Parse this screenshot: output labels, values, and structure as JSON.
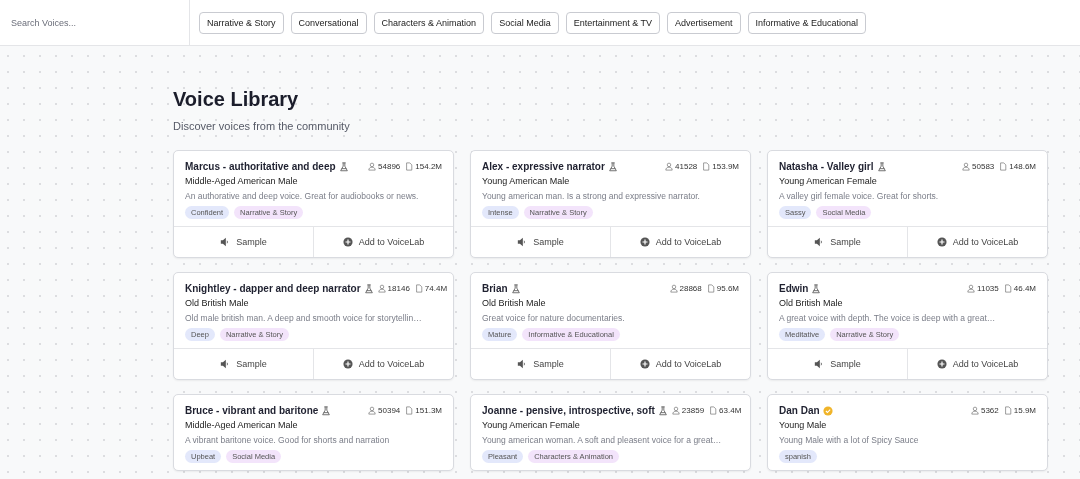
{
  "search": {
    "placeholder": "Search Voices..."
  },
  "filters": [
    {
      "label": "Narrative & Story"
    },
    {
      "label": "Conversational"
    },
    {
      "label": "Characters & Animation"
    },
    {
      "label": "Social Media"
    },
    {
      "label": "Entertainment & TV"
    },
    {
      "label": "Advertisement"
    },
    {
      "label": "Informative & Educational"
    }
  ],
  "heading": {
    "title": "Voice Library",
    "subtitle": "Discover voices from the community"
  },
  "voices": [
    {
      "name": "Marcus - authoritative and deep",
      "lab": true,
      "verified": false,
      "users": "54896",
      "size": "154.2M",
      "type": "Middle-Aged American Male",
      "description": "An authorative and deep voice. Great for audiobooks or news.",
      "tags": [
        {
          "label": "Confident",
          "kind": "mood"
        },
        {
          "label": "Narrative & Story",
          "kind": "category"
        }
      ],
      "actions": [
        {
          "label": "Sample",
          "kind": "sample"
        },
        {
          "label": "Add to VoiceLab",
          "kind": "add"
        }
      ]
    },
    {
      "name": "Alex - expressive narrator",
      "lab": true,
      "verified": false,
      "users": "41528",
      "size": "153.9M",
      "type": "Young American Male",
      "description": "Young american man. Is a strong and expressive narrator.",
      "tags": [
        {
          "label": "Intense",
          "kind": "mood"
        },
        {
          "label": "Narrative & Story",
          "kind": "category"
        }
      ],
      "actions": [
        {
          "label": "Sample",
          "kind": "sample"
        },
        {
          "label": "Add to VoiceLab",
          "kind": "add"
        }
      ]
    },
    {
      "name": "Natasha - Valley girl",
      "lab": true,
      "verified": false,
      "users": "50583",
      "size": "148.6M",
      "type": "Young American Female",
      "description": "A valley girl female voice. Great for shorts.",
      "tags": [
        {
          "label": "Sassy",
          "kind": "mood"
        },
        {
          "label": "Social Media",
          "kind": "category"
        }
      ],
      "actions": [
        {
          "label": "Sample",
          "kind": "sample"
        },
        {
          "label": "Add to VoiceLab",
          "kind": "add"
        }
      ]
    },
    {
      "name": "Knightley - dapper and deep narrator",
      "lab": true,
      "verified": false,
      "users": "18146",
      "size": "74.4M",
      "type": "Old British Male",
      "description": "Old male british man. A deep and smooth voice for storytellin…",
      "tags": [
        {
          "label": "Deep",
          "kind": "mood"
        },
        {
          "label": "Narrative & Story",
          "kind": "category"
        }
      ],
      "actions": [
        {
          "label": "Sample",
          "kind": "sample"
        },
        {
          "label": "Add to VoiceLab",
          "kind": "add"
        }
      ]
    },
    {
      "name": "Brian",
      "lab": true,
      "verified": false,
      "users": "28868",
      "size": "95.6M",
      "type": "Old British Male",
      "description": "Great voice for nature documentaries.",
      "tags": [
        {
          "label": "Mature",
          "kind": "mood"
        },
        {
          "label": "Informative & Educational",
          "kind": "category"
        }
      ],
      "actions": [
        {
          "label": "Sample",
          "kind": "sample"
        },
        {
          "label": "Add to VoiceLab",
          "kind": "add"
        }
      ]
    },
    {
      "name": "Edwin",
      "lab": true,
      "verified": false,
      "users": "11035",
      "size": "46.4M",
      "type": "Old British Male",
      "description": "A great voice with depth. The voice is deep with a great…",
      "tags": [
        {
          "label": "Meditative",
          "kind": "mood"
        },
        {
          "label": "Narrative & Story",
          "kind": "category"
        }
      ],
      "actions": [
        {
          "label": "Sample",
          "kind": "sample"
        },
        {
          "label": "Add to VoiceLab",
          "kind": "add"
        }
      ]
    },
    {
      "name": "Bruce - vibrant and baritone",
      "lab": true,
      "verified": false,
      "users": "50394",
      "size": "151.3M",
      "type": "Middle-Aged American Male",
      "description": "A vibrant baritone voice. Good for shorts and narration",
      "tags": [
        {
          "label": "Upbeat",
          "kind": "mood"
        },
        {
          "label": "Social Media",
          "kind": "category"
        }
      ]
    },
    {
      "name": "Joanne - pensive, introspective, soft",
      "lab": true,
      "verified": false,
      "users": "23859",
      "size": "63.4M",
      "type": "Young American Female",
      "description": "Young american woman. A soft and pleasent voice for a great…",
      "tags": [
        {
          "label": "Pleasant",
          "kind": "mood"
        },
        {
          "label": "Characters & Animation",
          "kind": "category"
        }
      ]
    },
    {
      "name": "Dan Dan",
      "lab": false,
      "verified": true,
      "users": "5362",
      "size": "15.9M",
      "type": "Young Male",
      "description": "Young Male with a lot of Spicy Sauce",
      "tags": [
        {
          "label": "spanish",
          "kind": "mood"
        }
      ]
    }
  ]
}
